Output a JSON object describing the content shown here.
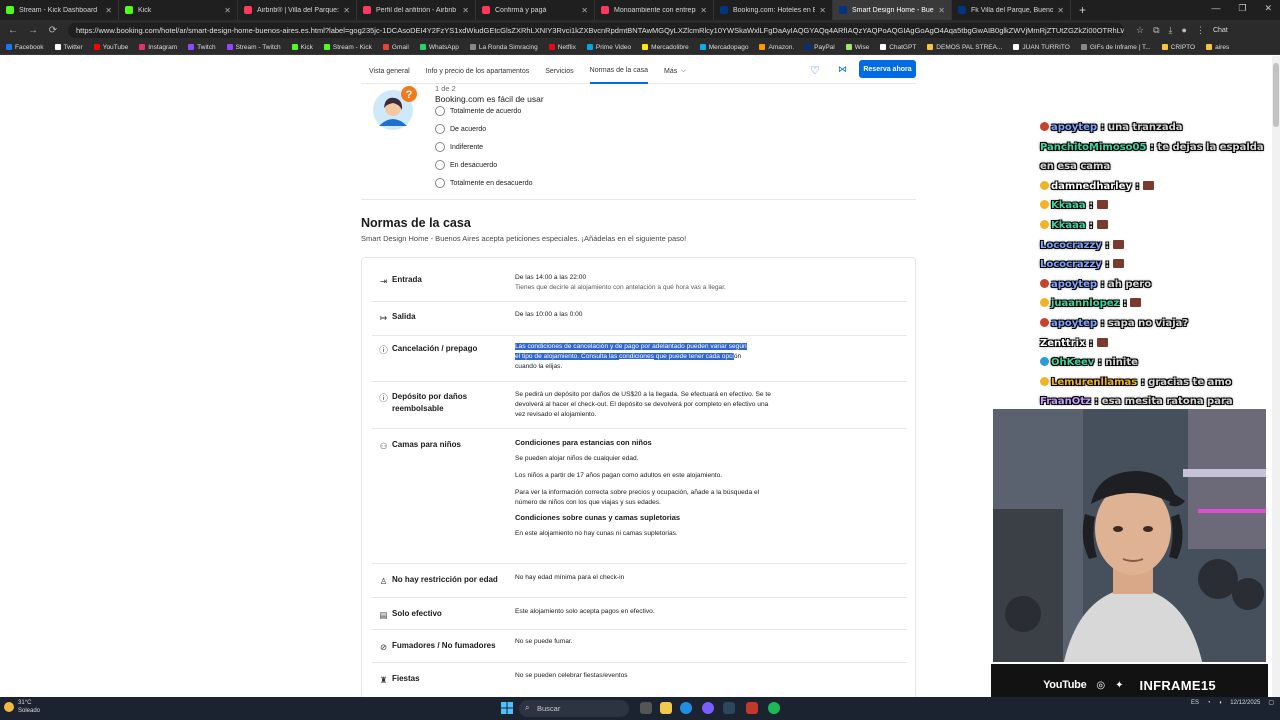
{
  "browser": {
    "tabs": [
      {
        "title": "Stream - Kick Dashboard",
        "color": "#53fc18"
      },
      {
        "title": "Kick",
        "color": "#53fc18"
      },
      {
        "title": "Airbnb® | Villa del Parque: Alojam",
        "color": "#ff385c"
      },
      {
        "title": "Perfil del anfitrión - Airbnb",
        "color": "#ff385c"
      },
      {
        "title": "Confirmá y pagá",
        "color": "#ff385c"
      },
      {
        "title": "Monoambiente con entrepiso - D",
        "color": "#ff385c"
      },
      {
        "title": "Booking.com: Hoteles en Buenos A",
        "color": "#003580"
      },
      {
        "title": "Smart Design Home - Buenos Aires",
        "color": "#003580",
        "active": true
      },
      {
        "title": "Fk Villa del Parque, Buenos Aires ,",
        "color": "#003580"
      }
    ],
    "new_tab": "+",
    "url": "https://www.booking.com/hotel/ar/smart-design-home-buenos-aires.es.html?label=gog235jc-1DCAsoDEI4Y2FzYS1xdWiudGEtcGlsZXRhLXNIY3Rvci1kZXBvcnRpdmtBNTAwMGQyLXZlcmRlcy10YWSkaWxlLFgDaAyIAQGYAQq4ARfIAQzYAQPoAQGIAgGoAgO4Aqa5tbgGwAIB0glkZWVjMmRjZTUtZGZkZi00OTRhLWI1ZDQtN2Y0YmYxMjUwNGQ...",
    "chat_label": "Chat",
    "bookmarks": [
      {
        "label": "Facebook",
        "color": "#1877f2"
      },
      {
        "label": "Twitter",
        "color": "#ffffff"
      },
      {
        "label": "YouTube",
        "color": "#ff0000"
      },
      {
        "label": "Instagram",
        "color": "#e1306c"
      },
      {
        "label": "Twitch",
        "color": "#9146ff"
      },
      {
        "label": "Stream - Twitch",
        "color": "#9146ff"
      },
      {
        "label": "Kick",
        "color": "#53fc18"
      },
      {
        "label": "Stream - Kick",
        "color": "#53fc18"
      },
      {
        "label": "Gmail",
        "color": "#ea4335"
      },
      {
        "label": "WhatsApp",
        "color": "#25d366"
      },
      {
        "label": "La Ronda Simracing",
        "color": "#888888"
      },
      {
        "label": "Netflix",
        "color": "#e50914"
      },
      {
        "label": "Prime Video",
        "color": "#00a8e1"
      },
      {
        "label": "Mercadolibre",
        "color": "#ffe600"
      },
      {
        "label": "Mercadopago",
        "color": "#00b1ea"
      },
      {
        "label": "Amazon.",
        "color": "#ff9900"
      },
      {
        "label": "PayPal",
        "color": "#003087"
      },
      {
        "label": "Wise",
        "color": "#9fe870"
      },
      {
        "label": "ChatGPT",
        "color": "#ffffff"
      },
      {
        "label": "DEMOS PAL STREA...",
        "color": "#f5c542"
      },
      {
        "label": "JUAN TURRITO",
        "color": "#ffffff"
      },
      {
        "label": "GIFs de Inframe | T...",
        "color": "#888888"
      },
      {
        "label": "CRIPTO",
        "color": "#f5c542"
      },
      {
        "label": "aires",
        "color": "#f5c542"
      }
    ]
  },
  "subnav": {
    "items": [
      "Vista general",
      "Info y precio de los apartamentos",
      "Servicios",
      "Normas de la casa",
      "Más"
    ],
    "active_index": 3,
    "more_chevron": "⌵",
    "reserve_label": "Reserva ahora"
  },
  "survey": {
    "step": "1 de 2",
    "question": "Booking.com es fácil de usar",
    "options": [
      "Totalmente de acuerdo",
      "De acuerdo",
      "Indiferente",
      "En desacuerdo",
      "Totalmente en desacuerdo"
    ]
  },
  "house_rules": {
    "title": "Normas de la casa",
    "subtitle": "Smart Design Home - Buenos Aires acepta peticiones especiales. ¡Añádelas en el siguiente paso!",
    "checkin": {
      "label": "Entrada",
      "icon": "arrow-in-icon",
      "time": "De las 14:00 a las 22:00",
      "note": "Tienes que decirle al alojamiento con antelación a qué hora vas a llegar."
    },
    "checkout": {
      "label": "Salida",
      "icon": "arrow-out-icon",
      "time": "De las 10:00 a las 0:00"
    },
    "cancellation": {
      "label": "Cancelación / prepago",
      "icon": "info-icon",
      "text_highlighted_1": "Las condiciones de cancelación y de pago por adelantado pueden variar según",
      "text_highlighted_2": "el tipo de alojamiento. Consulta las",
      "link": "condiciones",
      "text_highlighted_3": "que puede tener cada opci",
      "text_rest_1": "ón",
      "text_rest_2": "cuando la elijas."
    },
    "deposit": {
      "label": "Depósito por daños reembolsable",
      "icon": "info-icon",
      "text": "Se pedirá un depósito por daños de US$20 a la llegada. Se efectuará en efectivo. Se te devolverá al hacer el check-out. El depósito se devolverá por completo en efectivo una vez revisado el alojamiento."
    },
    "children": {
      "label": "Camas para niños",
      "icon": "family-icon",
      "heading": "Condiciones para estancias con niños",
      "p1": "Se pueden alojar niños de cualquier edad.",
      "p2": "Los niños a partir de 17 años pagan como adultos en este alojamiento.",
      "p3": "Para ver la información correcta sobre precios y ocupación, añade a la búsqueda el número de niños con los que viajas y sus edades.",
      "heading2": "Condiciones sobre cunas y camas supletorias",
      "p4": "En este alojamiento no hay cunas ni camas supletorias."
    },
    "age": {
      "label": "No hay restricción por edad",
      "icon": "person-icon",
      "text": "No hay edad mínima para el check-in"
    },
    "cash": {
      "label": "Solo efectivo",
      "icon": "cash-icon",
      "text": "Este alojamiento solo acepta pagos en efectivo."
    },
    "smoking": {
      "label": "Fumadores / No fumadores",
      "icon": "no-smoking-icon",
      "text": "No se puede fumar."
    },
    "parties": {
      "label": "Fiestas",
      "icon": "party-icon",
      "text": "No se pueden celebrar fiestas/eventos"
    }
  },
  "chat": {
    "messages": [
      {
        "user": "apoytep",
        "color": "#7fa3ff",
        "text": ": una tranzada",
        "badge": "#c8412b"
      },
      {
        "user": "PanchitoMimoso05",
        "color": "#3fd6a0",
        "text": ": te dejas la espalda en esa cama",
        "badge": ""
      },
      {
        "user": "damnedharley",
        "color": "#ffffff",
        "text": ":",
        "badge": "#f0b428"
      },
      {
        "user": "Kkaaa",
        "color": "#3fd6a0",
        "text": ":",
        "badge": "#f0b428"
      },
      {
        "user": "Kkaaa",
        "color": "#3fd6a0",
        "text": ":",
        "badge": "#f0b428"
      },
      {
        "user": "Lococrazzy",
        "color": "#7fa3ff",
        "text": ":",
        "badge": ""
      },
      {
        "user": "Lococrazzy",
        "color": "#7fa3ff",
        "text": ":",
        "badge": ""
      },
      {
        "user": "apoytep",
        "color": "#7fa3ff",
        "text": ": ah pero",
        "badge": "#c8412b"
      },
      {
        "user": "juaannlopez",
        "color": "#3fd6a0",
        "text": ":",
        "badge": "#f0b428"
      },
      {
        "user": "apoytep",
        "color": "#7fa3ff",
        "text": ": sapa no viaja?",
        "badge": "#c8412b"
      },
      {
        "user": "Zenttrix",
        "color": "#ffffff",
        "text": ":",
        "badge": ""
      },
      {
        "user": "OhKeev",
        "color": "#3fd6a0",
        "text": ": ninite",
        "badge": "#2b9bd8"
      },
      {
        "user": "Lemurenllamas",
        "color": "#f0b428",
        "text": ": gracias te amo",
        "badge": "#f0b428"
      },
      {
        "user": "FraanOtz",
        "color": "#c59bff",
        "text": ": esa mesita ratona para peinar merluza, clavel",
        "badge": ""
      },
      {
        "user": "FraanOtz",
        "color": "#c59bff",
        "text": ":",
        "badge": ""
      }
    ]
  },
  "webcam_bar": {
    "youtube": "YouTube",
    "brand": "INFRAME15"
  },
  "taskbar": {
    "temperature": "31°C",
    "condition": "Soleado",
    "search_placeholder": "Buscar",
    "lang": "ES",
    "date": "12/12/2025"
  }
}
